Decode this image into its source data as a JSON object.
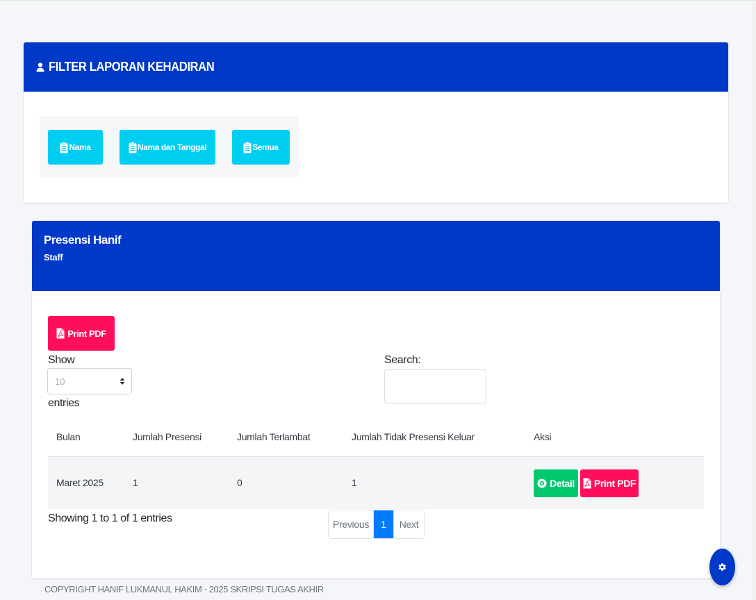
{
  "filter": {
    "title": "FILTER LAPORAN KEHADIRAN",
    "buttons": {
      "nama": "Nama",
      "nama_tanggal": "Nama dan Tanggal",
      "semua": "Semua"
    }
  },
  "presensi": {
    "title": "Presensi Hanif",
    "subtitle": "Staff",
    "print_label": "Print PDF",
    "show_label": "Show",
    "entries_value": "10",
    "entries_label": "entries",
    "search_label": "Search:",
    "search_value": "",
    "table": {
      "headers": [
        "Bulan",
        "Jumlah Presensi",
        "Jumlah Terlambat",
        "Jumlah Tidak Presensi Keluar",
        "Aksi"
      ],
      "rows": [
        {
          "bulan": "Maret 2025",
          "jumlah_presensi": "1",
          "jumlah_terlambat": "0",
          "jumlah_tidak_presensi_keluar": "1",
          "detail_label": "Detail",
          "print_label": "Print PDF"
        }
      ]
    },
    "showing_text": "Showing 1 to 1 of 1 entries",
    "pagination": {
      "previous": "Previous",
      "current": "1",
      "next": "Next"
    }
  },
  "footer": {
    "text": "COPYRIGHT HANIF LUKMANUL HAKIM - 2025 SKRIPSI TUGAS AKHIR"
  },
  "colors": {
    "header_blue": "#0038c8",
    "cyan": "#00cdf2",
    "pink": "#ff0f5b",
    "green": "#00c86b",
    "pagination_active": "#007bff"
  },
  "icons": [
    "user-icon",
    "clipboard-icon",
    "pdf-icon",
    "eye-icon",
    "gear-icon",
    "select-caret-icon"
  ]
}
